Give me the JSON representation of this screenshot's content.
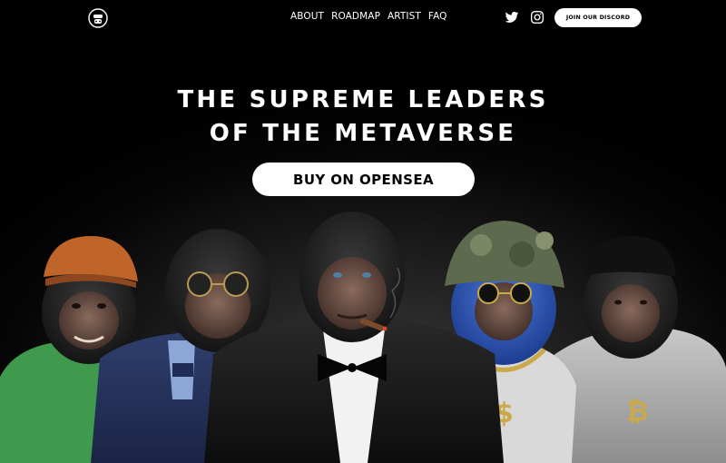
{
  "nav": {
    "logo_icon": "gorilla-logo-icon",
    "links": [
      "ABOUT",
      "ROADMAP",
      "ARTIST",
      "FAQ"
    ],
    "twitter_icon": "twitter-icon",
    "instagram_icon": "instagram-icon",
    "discord_label": "JOIN OUR DISCORD"
  },
  "hero": {
    "title_line1": "THE SUPREME LEADERS",
    "title_line2": "OF THE METAVERSE",
    "cta_label": "BUY ON OPENSEA"
  },
  "colors": {
    "background": "#000000",
    "text": "#ffffff",
    "button_bg": "#ffffff",
    "button_text": "#000000"
  },
  "artwork": {
    "subject": "five gorilla characters",
    "characters": [
      "gorilla-orange-cap-green-shirt",
      "gorilla-sunglasses-blue-suit",
      "gorilla-tuxedo-cigar",
      "gorilla-camo-bucket-hat-blue-fur",
      "gorilla-black-cap-hoodie"
    ]
  }
}
